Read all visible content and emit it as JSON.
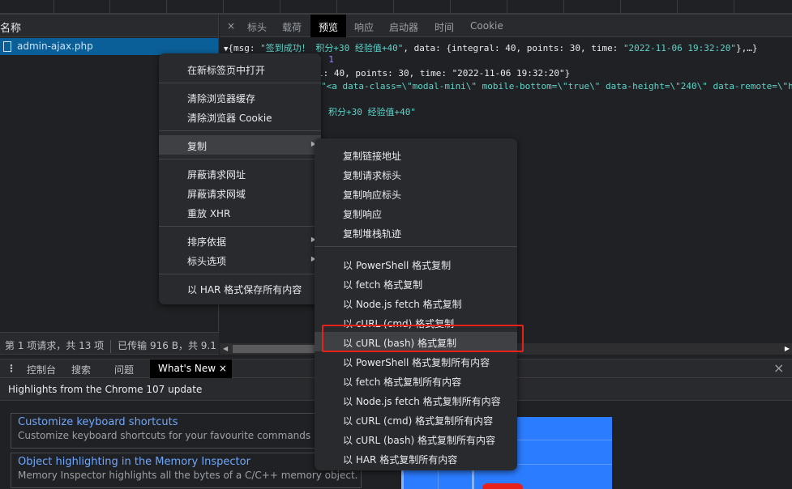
{
  "network": {
    "name_header": "名称",
    "request": "admin-ajax.php",
    "status_requests": "第 1 项请求，共 13 项",
    "status_transfer": "已传输 916 B，共 9.1 kB"
  },
  "detail_tabs": {
    "close": "×",
    "items": [
      "标头",
      "载荷",
      "预览",
      "响应",
      "启动器",
      "时间",
      "Cookie"
    ],
    "active": "预览"
  },
  "preview": {
    "line1_prefix": "▼",
    "line1_a": "{msg: ",
    "line1_b": "\"签到成功！ 积分+30 经验值+40\"",
    "line1_c": ", data: {integral: 40, points: 30, time: ",
    "line1_d": "\"2022-11-06 19:32:20\"",
    "line1_e": "},…}",
    "line2_a": ": ",
    "line2_b": "1",
    "line3": "l: 40, points: 30, time: \"2022-11-06 19:32:20\"}",
    "line4": "\"<a data-class=\\\"modal-mini\\\" mobile-bottom=\\\"true\\\" data-height=\\\"240\\\" data-remote=\\\"ht",
    "line5": "积分+30 经验值+40\""
  },
  "drawer": {
    "tabs": [
      "控制台",
      "搜索",
      "问题",
      "What's New"
    ],
    "tab_close": "×",
    "close": "×",
    "highlights": "Highlights from the Chrome 107 update",
    "cards": [
      {
        "title": "Customize keyboard shortcuts",
        "desc": "Customize keyboard shortcuts for your favourite commands in DevTools."
      },
      {
        "title": "Object highlighting in the Memory Inspector",
        "desc": "Memory Inspector highlights all the bytes of a C/C++ memory object."
      }
    ]
  },
  "context_menu": {
    "items": [
      "在新标签页中打开",
      "清除浏览器缓存",
      "清除浏览器 Cookie",
      "复制",
      "屏蔽请求网址",
      "屏蔽请求网域",
      "重放 XHR",
      "排序依据",
      "标头选项",
      "以 HAR 格式保存所有内容"
    ],
    "arrow": "▶"
  },
  "copy_submenu": {
    "items": [
      "复制链接地址",
      "复制请求标头",
      "复制响应标头",
      "复制响应",
      "复制堆栈轨迹",
      "以 PowerShell 格式复制",
      "以 fetch 格式复制",
      "以 Node.js fetch 格式复制",
      "以 cURL (cmd) 格式复制",
      "以 cURL (bash) 格式复制",
      "以 PowerShell 格式复制所有内容",
      "以 fetch 格式复制所有内容",
      "以 Node.js fetch 格式复制所有内容",
      "以 cURL (cmd) 格式复制所有内容",
      "以 cURL (bash) 格式复制所有内容",
      "以 HAR 格式复制所有内容"
    ],
    "highlighted": "以 cURL (bash) 格式复制"
  },
  "colors": {
    "selection": "#0b5f99",
    "annotation": "#e8211b",
    "link": "#6ea7ff"
  }
}
